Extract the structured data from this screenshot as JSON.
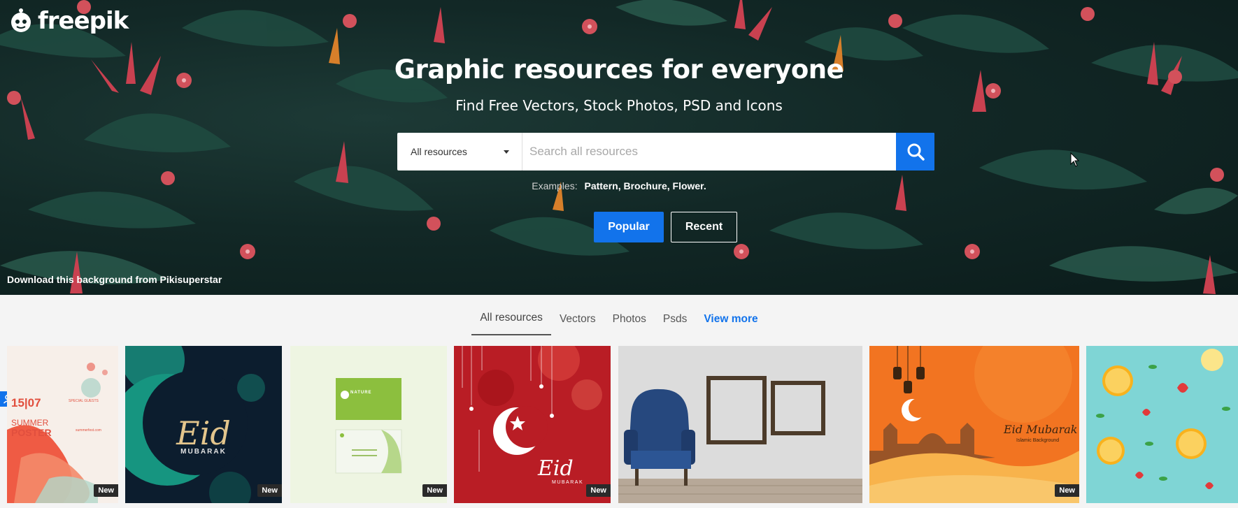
{
  "brand": {
    "name": "freepik"
  },
  "hero": {
    "title": "Graphic resources for everyone",
    "subtitle": "Find Free Vectors, Stock Photos, PSD and Icons",
    "credit": "Download this background from Pikisuperstar"
  },
  "search": {
    "category": "All resources",
    "placeholder": "Search all resources",
    "examples_label": "Examples:",
    "examples": "Pattern, Brochure, Flower."
  },
  "buttons": {
    "popular": "Popular",
    "recent": "Recent"
  },
  "tabs": {
    "all": "All resources",
    "vectors": "Vectors",
    "photos": "Photos",
    "psds": "Psds",
    "more": "View more"
  },
  "tiles": [
    {
      "badge": "New",
      "date": "15|07",
      "line1": "SUMMER",
      "line2": "POSTER",
      "line3": "summerfest.com",
      "line4": "SPECIAL GUESTS"
    },
    {
      "badge": "New",
      "title": "Eid",
      "sub": "MUBARAK"
    },
    {
      "badge": "New",
      "card": "NATURE"
    },
    {
      "badge": "New",
      "title": "Eid",
      "sub": "MUBARAK"
    },
    {},
    {
      "badge": "New",
      "title": "Eid Mubarak",
      "sub": "Islamic Background"
    },
    {}
  ],
  "colors": {
    "accent": "#1273eb",
    "badge": "#2a2a2a"
  }
}
